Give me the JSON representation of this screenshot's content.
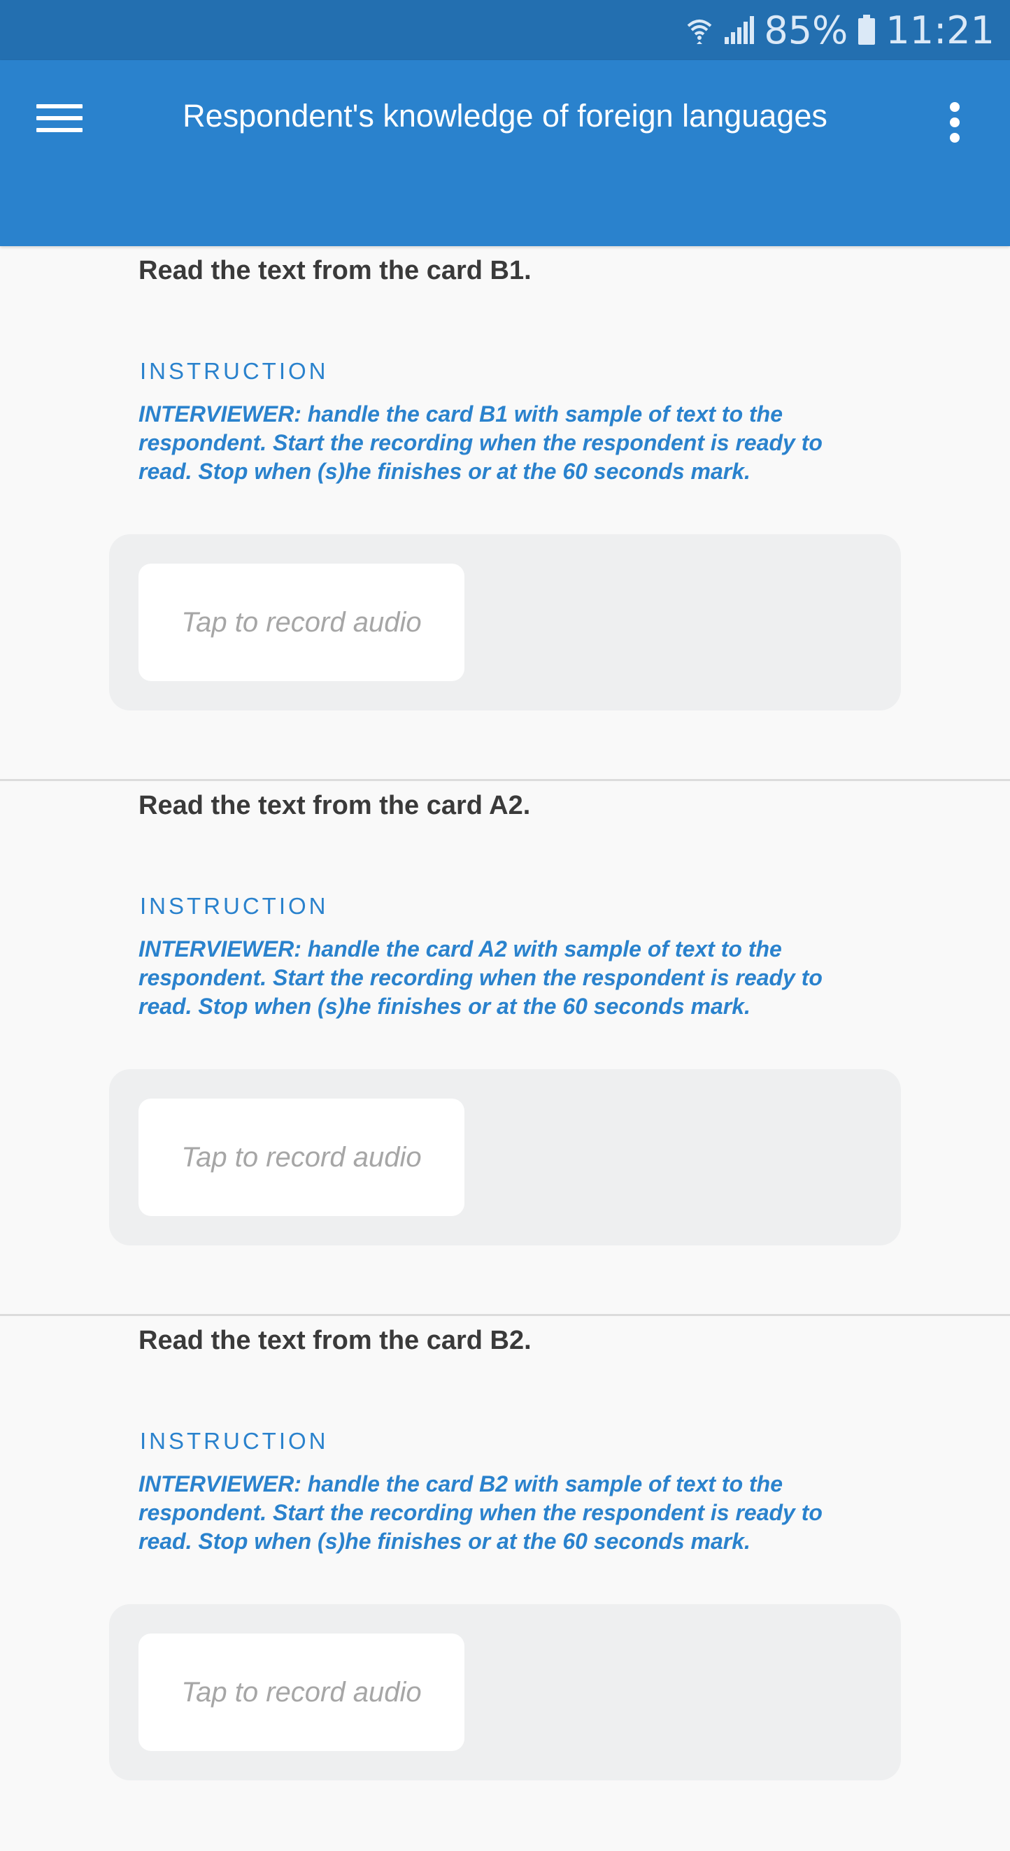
{
  "status_bar": {
    "wifi_icon": "wifi-icon",
    "signal_icon": "cell-signal-icon",
    "battery_percent": "85%",
    "battery_icon": "battery-icon",
    "time": "11:21"
  },
  "app_bar": {
    "menu_icon": "hamburger-menu-icon",
    "title": "Respondent's knowledge of foreign languages",
    "more_icon": "more-vert-icon"
  },
  "questions": [
    {
      "title": "Read the text from the card B1.",
      "instruction_label": "INSTRUCTION",
      "instruction_text": "INTERVIEWER: handle the card B1 with sample of text to the respondent. Start the recording when the respondent is ready to read. Stop when (s)he finishes or at the 60 seconds mark.",
      "record_label": "Tap to record audio"
    },
    {
      "title": "Read the text from the card A2.",
      "instruction_label": "INSTRUCTION",
      "instruction_text": "INTERVIEWER: handle the card A2 with sample of text to the respondent. Start the recording when the respondent is ready to read. Stop when (s)he finishes or at the 60 seconds mark.",
      "record_label": "Tap to record audio"
    },
    {
      "title": "Read the text from the card B2.",
      "instruction_label": "INSTRUCTION",
      "instruction_text": "INTERVIEWER: handle the card B2 with sample of text to the respondent. Start the recording when the respondent is ready to read. Stop when (s)he finishes or at the 60 seconds mark.",
      "record_label": "Tap to record audio"
    }
  ],
  "colors": {
    "status_bar": "#236fb0",
    "app_bar": "#2a82cd",
    "accent_text": "#2a82cd",
    "background": "#f9f9f9",
    "panel": "#eeeff0"
  }
}
